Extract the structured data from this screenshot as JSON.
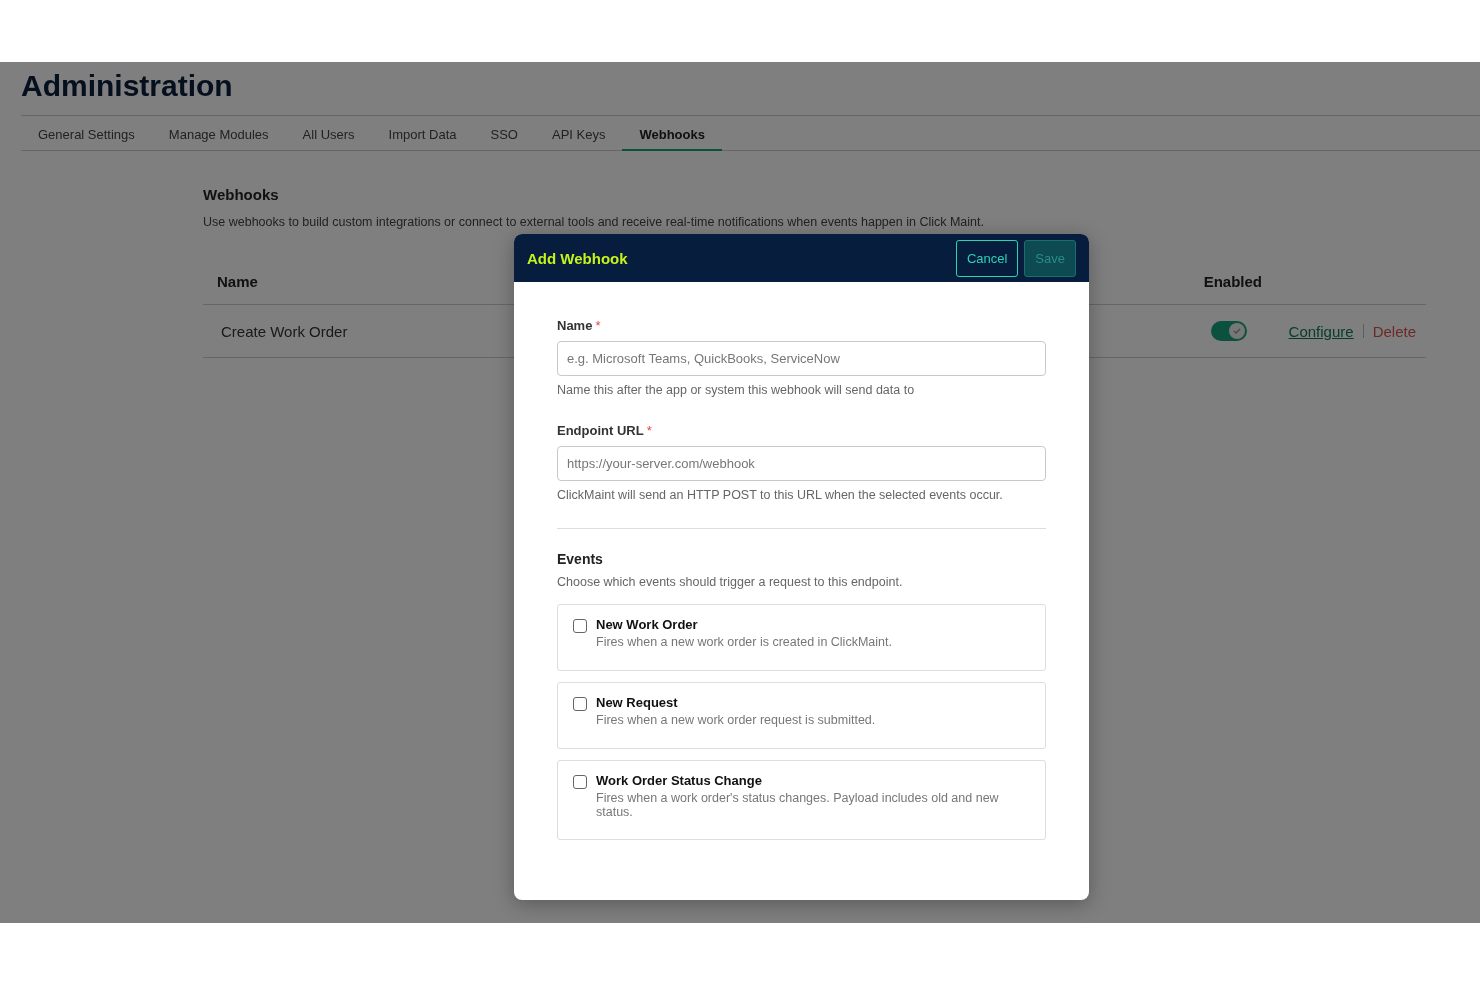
{
  "page": {
    "title": "Administration"
  },
  "tabs": [
    {
      "label": "General Settings",
      "selected": false
    },
    {
      "label": "Manage Modules",
      "selected": false
    },
    {
      "label": "All Users",
      "selected": false
    },
    {
      "label": "Import Data",
      "selected": false
    },
    {
      "label": "SSO",
      "selected": false
    },
    {
      "label": "API Keys",
      "selected": false
    },
    {
      "label": "Webhooks",
      "selected": true
    }
  ],
  "section": {
    "title": "Webhooks",
    "description": "Use webhooks to build custom integrations or connect to external tools and receive real-time notifications when events happen in Click Maint."
  },
  "table": {
    "columns": [
      "Name",
      "Enabled"
    ],
    "rows": [
      {
        "name": "Create Work Order",
        "enabled": true,
        "actions": [
          {
            "label": "Configure",
            "kind": "link"
          },
          {
            "label": "Delete",
            "kind": "danger"
          }
        ]
      }
    ]
  },
  "dialog": {
    "title": "Add Webhook",
    "buttons": [
      {
        "label": "Cancel",
        "kind": "outline",
        "disabled": false
      },
      {
        "label": "Save",
        "kind": "primary",
        "disabled": true
      }
    ],
    "fields": [
      {
        "label": "Name",
        "required_mark": "*",
        "placeholder": "e.g. Microsoft Teams, QuickBooks, ServiceNow",
        "help": "Name this after the app or system this webhook will send data to"
      },
      {
        "label": "Endpoint URL",
        "required_mark": "*",
        "placeholder": "https://your-server.com/webhook",
        "help": "ClickMaint will send an HTTP POST to this URL when the selected events occur."
      }
    ],
    "events": {
      "title": "Events",
      "description": "Choose which events should trigger a request to this endpoint.",
      "items": [
        {
          "label": "New Work Order",
          "description": "Fires when a new work order is created in ClickMaint.",
          "checked": false
        },
        {
          "label": "New Request",
          "description": "Fires when a new work order request is submitted.",
          "checked": false
        },
        {
          "label": "Work Order Status Change",
          "description": "Fires when a work order's status changes. Payload includes old and new status.",
          "checked": false
        }
      ]
    }
  }
}
